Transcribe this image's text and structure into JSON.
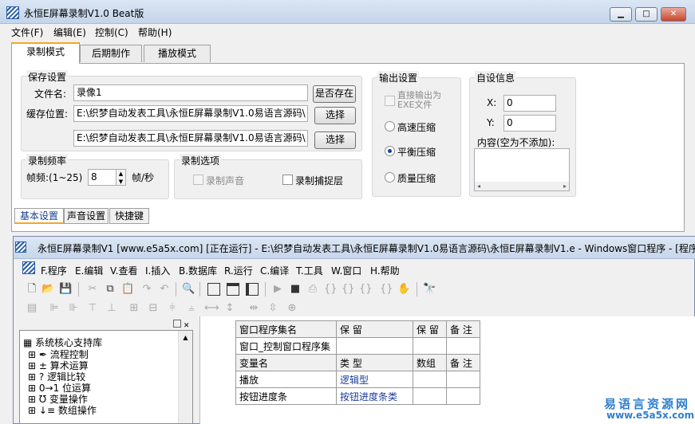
{
  "window": {
    "title": "永恒E屏幕录制V1.0 Beat版",
    "min": "▁",
    "max": "□",
    "close": "✕"
  },
  "menu": [
    "文件(F)",
    "编辑(E)",
    "控制(C)",
    "帮助(H)"
  ],
  "tabs": [
    "录制模式",
    "后期制作",
    "播放模式"
  ],
  "save": {
    "group": "保存设置",
    "filename_label": "文件名:",
    "filename_value": "录像1",
    "exists_button": "是否存在",
    "location_label": "缓存位置:",
    "path1": "E:\\织梦自动发表工具\\永恒E屏幕录制V1.0易语言源码\\",
    "path2": "E:\\织梦自动发表工具\\永恒E屏幕录制V1.0易语言源码\\",
    "browse_button": "选择"
  },
  "output": {
    "group": "输出设置",
    "direct_exe": "直接输出为EXE文件",
    "fast": "高速压缩",
    "balanced": "平衡压缩",
    "quality": "质量压缩"
  },
  "custom": {
    "group": "自设信息",
    "x_label": "X:",
    "x_value": "0",
    "y_label": "Y:",
    "y_value": "0",
    "content_label": "内容(空为不添加):"
  },
  "freq": {
    "group": "录制频率",
    "label": "帧频:(1~25)",
    "value": "8",
    "unit": "帧/秒"
  },
  "options": {
    "group": "录制选项",
    "sound": "录制声音",
    "cursor": "录制捕捉层"
  },
  "subtabs": [
    "基本设置",
    "声音设置",
    "快捷键"
  ],
  "ide": {
    "title": "永恒E屏幕录制V1 [www.e5a5x.com] [正在运行] - E:\\织梦自动发表工具\\永恒E屏幕录制V1.0易语言源码\\永恒E屏幕录制V1.e - Windows窗口程序 - [程序",
    "menu": [
      "F.程序",
      "E.编辑",
      "V.查看",
      "I.插入",
      "B.数据库",
      "R.运行",
      "C.编译",
      "T.工具",
      "W.窗口",
      "H.帮助"
    ],
    "tree": [
      "系统核心支持库",
      "流程控制",
      "算术运算",
      "逻辑比较",
      "位运算",
      "变量操作",
      "数组操作"
    ],
    "table": [
      [
        "窗口程序集名",
        "保 留",
        "保 留",
        "备 注"
      ],
      [
        "窗口_控制窗口程序集",
        "",
        "",
        ""
      ],
      [
        "变量名",
        "类 型",
        "数组",
        "备 注"
      ],
      [
        "播放",
        "逻辑型",
        "",
        ""
      ],
      [
        "按钮进度条",
        "按钮进度条类",
        "",
        ""
      ]
    ]
  },
  "watermark": {
    "cn": "易语言资源网",
    "url": "www.e5a5x.com"
  }
}
